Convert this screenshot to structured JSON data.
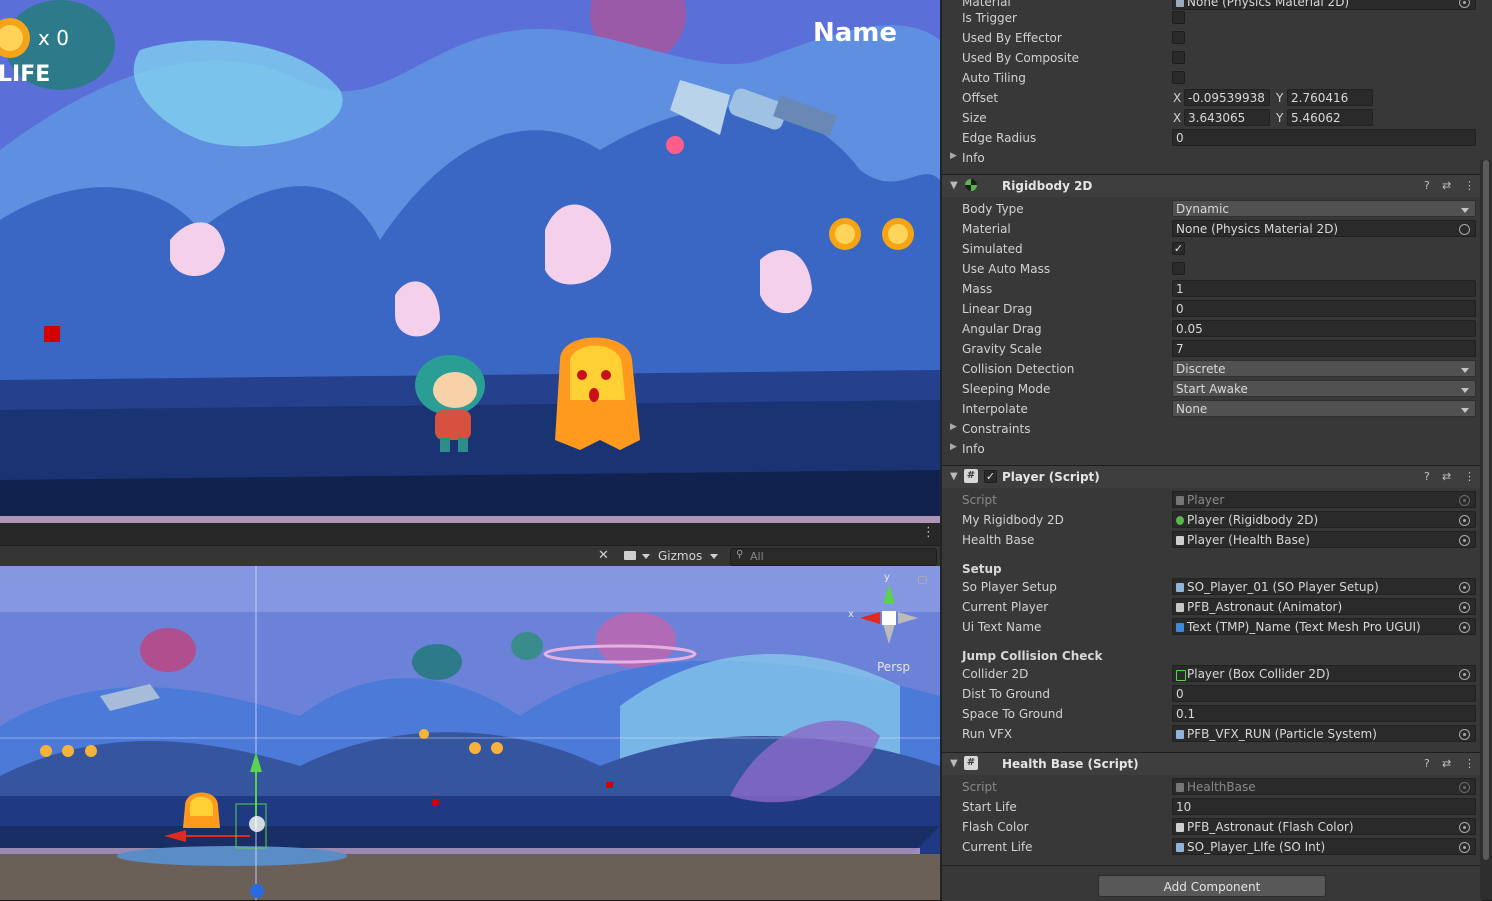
{
  "game_view": {
    "coin_count": "x 0",
    "life_label": "LIFE",
    "player_name": "Name"
  },
  "scene_toolbar": {
    "gizmos_label": "Gizmos",
    "search_placeholder": "All",
    "persp_label": "Persp",
    "axis_y": "y",
    "axis_x": "x"
  },
  "inspector": {
    "top_rows": [
      {
        "label": "Material",
        "value": "None (Physics Material 2D)"
      },
      {
        "label": "Is Trigger"
      },
      {
        "label": "Used By Effector"
      },
      {
        "label": "Used By Composite"
      },
      {
        "label": "Auto Tiling"
      }
    ],
    "offset": {
      "label": "Offset",
      "x": "-0.09539938",
      "y": "2.760416"
    },
    "size": {
      "label": "Size",
      "x": "3.643065",
      "y": "5.46062"
    },
    "edge_radius": {
      "label": "Edge Radius",
      "value": "0"
    },
    "info_label": "Info",
    "x_label": "X",
    "y_label": "Y",
    "rigidbody": {
      "title": "Rigidbody 2D",
      "body_type": {
        "label": "Body Type",
        "value": "Dynamic"
      },
      "material": {
        "label": "Material",
        "value": "None (Physics Material 2D)"
      },
      "simulated": {
        "label": "Simulated",
        "checked": "✓"
      },
      "use_auto_mass": {
        "label": "Use Auto Mass"
      },
      "mass": {
        "label": "Mass",
        "value": "1"
      },
      "linear_drag": {
        "label": "Linear Drag",
        "value": "0"
      },
      "angular_drag": {
        "label": "Angular Drag",
        "value": "0.05"
      },
      "gravity_scale": {
        "label": "Gravity Scale",
        "value": "7"
      },
      "collision_detection": {
        "label": "Collision Detection",
        "value": "Discrete"
      },
      "sleeping_mode": {
        "label": "Sleeping Mode",
        "value": "Start Awake"
      },
      "interpolate": {
        "label": "Interpolate",
        "value": "None"
      },
      "constraints": "Constraints",
      "info": "Info"
    },
    "player_script": {
      "title": "Player (Script)",
      "script": {
        "label": "Script",
        "value": "Player"
      },
      "my_rigidbody": {
        "label": "My Rigidbody 2D",
        "value": "Player (Rigidbody 2D)"
      },
      "health_base": {
        "label": "Health Base",
        "value": "Player (Health Base)"
      },
      "setup_header": "Setup",
      "so_player_setup": {
        "label": "So Player Setup",
        "value": "SO_Player_01 (SO Player Setup)"
      },
      "current_player": {
        "label": "Current Player",
        "value": "PFB_Astronaut (Animator)"
      },
      "ui_text_name": {
        "label": "Ui Text Name",
        "value": "Text (TMP)_Name (Text Mesh Pro UGUI)"
      },
      "jump_header": "Jump Collision Check",
      "collider": {
        "label": "Collider 2D",
        "value": "Player (Box Collider 2D)"
      },
      "dist_to_ground": {
        "label": "Dist To Ground",
        "value": "0"
      },
      "space_to_ground": {
        "label": "Space To Ground",
        "value": "0.1"
      },
      "run_vfx": {
        "label": "Run VFX",
        "value": "PFB_VFX_RUN (Particle System)"
      }
    },
    "health_script": {
      "title": "Health Base (Script)",
      "script": {
        "label": "Script",
        "value": "HealthBase"
      },
      "start_life": {
        "label": "Start Life",
        "value": "10"
      },
      "flash_color": {
        "label": "Flash Color",
        "value": "PFB_Astronaut (Flash Color)"
      },
      "current_life": {
        "label": "Current Life",
        "value": "SO_Player_LIfe (SO Int)"
      }
    },
    "add_component": "Add Component"
  }
}
